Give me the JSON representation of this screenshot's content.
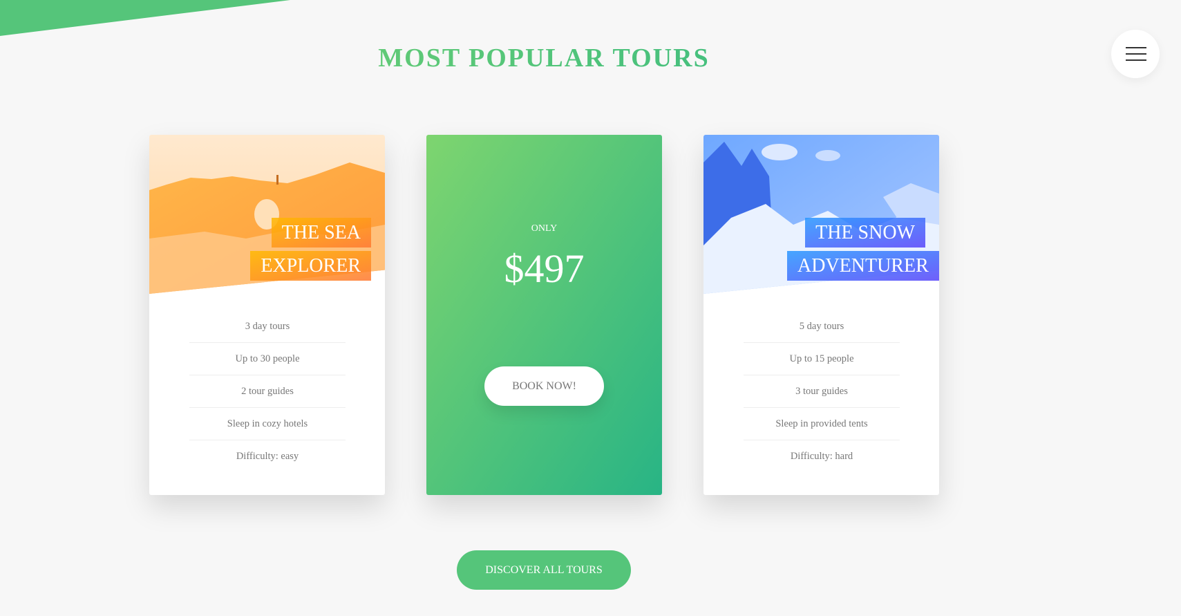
{
  "section": {
    "title": "MOST POPULAR TOURS"
  },
  "colors": {
    "primary_green": "#55c57a",
    "gradient_green_start": "#7ed56f",
    "gradient_green_end": "#28b485",
    "orange_start": "#ffb900",
    "orange_end": "#ff7730",
    "blue_start": "#2998ff",
    "blue_end": "#5643fa"
  },
  "navigation": {
    "menu_icon": "hamburger-menu-icon"
  },
  "cards": [
    {
      "heading_line1": "THE SEA",
      "heading_line2": "EXPLORER",
      "details": [
        "3 day tours",
        "Up to 30 people",
        "2 tour guides",
        "Sleep in cozy hotels",
        "Difficulty: easy"
      ]
    },
    {
      "price_label": "ONLY",
      "price": "$497",
      "button_label": "BOOK NOW!"
    },
    {
      "heading_line1": "THE SNOW",
      "heading_line2": "ADVENTURER",
      "details": [
        "5 day tours",
        "Up to 15 people",
        "3 tour guides",
        "Sleep in provided tents",
        "Difficulty: hard"
      ]
    }
  ],
  "cta": {
    "label": "DISCOVER ALL TOURS"
  }
}
